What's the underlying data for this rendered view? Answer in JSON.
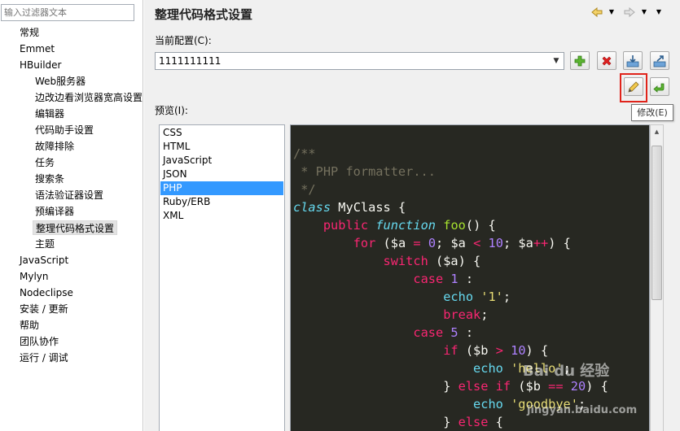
{
  "filter": {
    "placeholder": "输入过滤器文本"
  },
  "tree": [
    {
      "label": "常规",
      "level": 0
    },
    {
      "label": "Emmet",
      "level": 0
    },
    {
      "label": "HBuilder",
      "level": 0
    },
    {
      "label": "Web服务器",
      "level": 1
    },
    {
      "label": "边改边看浏览器宽高设置",
      "level": 1
    },
    {
      "label": "编辑器",
      "level": 1
    },
    {
      "label": "代码助手设置",
      "level": 1
    },
    {
      "label": "故障排除",
      "level": 1
    },
    {
      "label": "任务",
      "level": 1
    },
    {
      "label": "搜索条",
      "level": 1
    },
    {
      "label": "语法验证器设置",
      "level": 1
    },
    {
      "label": "预编译器",
      "level": 1
    },
    {
      "label": "整理代码格式设置",
      "level": 1,
      "selected": true
    },
    {
      "label": "主题",
      "level": 1
    },
    {
      "label": "JavaScript",
      "level": 0
    },
    {
      "label": "Mylyn",
      "level": 0
    },
    {
      "label": "Nodeclipse",
      "level": 0
    },
    {
      "label": "安装 / 更新",
      "level": 0
    },
    {
      "label": "帮助",
      "level": 0
    },
    {
      "label": "团队协作",
      "level": 0
    },
    {
      "label": "运行 / 调试",
      "level": 0
    }
  ],
  "page": {
    "title": "整理代码格式设置",
    "current_profile_label": "当前配置(C):",
    "current_profile_value": "1111111111",
    "preview_label": "预览(I):",
    "edit_tooltip": "修改(E)"
  },
  "icons": {
    "back": "back-arrow-icon",
    "forward": "forward-arrow-icon",
    "add": "plus-icon",
    "remove": "delete-x-icon",
    "import": "import-icon",
    "export": "export-icon",
    "edit": "pencil-icon",
    "undo": "undo-arrow-icon"
  },
  "languages": [
    {
      "label": "CSS"
    },
    {
      "label": "HTML"
    },
    {
      "label": "JavaScript"
    },
    {
      "label": "JSON"
    },
    {
      "label": "PHP",
      "selected": true
    },
    {
      "label": "Ruby/ERB"
    },
    {
      "label": "XML"
    }
  ],
  "code_lines": [
    [
      [
        "c-com",
        "/**"
      ]
    ],
    [
      [
        "c-com",
        " * PHP formatter..."
      ]
    ],
    [
      [
        "c-com",
        " */"
      ]
    ],
    [
      [
        "c-blue c-fn",
        "class"
      ],
      [
        "",
        " MyClass {"
      ]
    ],
    [
      [
        "",
        "    "
      ],
      [
        "c-kw",
        "public"
      ],
      [
        "",
        " "
      ],
      [
        "c-fn",
        "function"
      ],
      [
        "",
        " "
      ],
      [
        "c-name",
        "foo"
      ],
      [
        "",
        "() {"
      ]
    ],
    [
      [
        "",
        "        "
      ],
      [
        "c-kw",
        "for"
      ],
      [
        "",
        " ($a "
      ],
      [
        "c-kw",
        "="
      ],
      [
        "",
        " "
      ],
      [
        "c-num",
        "0"
      ],
      [
        "",
        "; $a "
      ],
      [
        "c-kw",
        "<"
      ],
      [
        "",
        " "
      ],
      [
        "c-num",
        "10"
      ],
      [
        "",
        "; $a"
      ],
      [
        "c-kw",
        "++"
      ],
      [
        "",
        ") {"
      ]
    ],
    [
      [
        "",
        "            "
      ],
      [
        "c-kw",
        "switch"
      ],
      [
        "",
        " ($a) {"
      ]
    ],
    [
      [
        "",
        "                "
      ],
      [
        "c-kw",
        "case"
      ],
      [
        "",
        " "
      ],
      [
        "c-num",
        "1"
      ],
      [
        "",
        " :"
      ]
    ],
    [
      [
        "",
        "                    "
      ],
      [
        "c-blue",
        "echo"
      ],
      [
        "",
        " "
      ],
      [
        "c-str",
        "'1'"
      ],
      [
        "",
        ";"
      ]
    ],
    [
      [
        "",
        "                    "
      ],
      [
        "c-kw",
        "break"
      ],
      [
        "",
        ";"
      ]
    ],
    [
      [
        "",
        "                "
      ],
      [
        "c-kw",
        "case"
      ],
      [
        "",
        " "
      ],
      [
        "c-num",
        "5"
      ],
      [
        "",
        " :"
      ]
    ],
    [
      [
        "",
        "                    "
      ],
      [
        "c-kw",
        "if"
      ],
      [
        "",
        " ($b "
      ],
      [
        "c-kw",
        ">"
      ],
      [
        "",
        " "
      ],
      [
        "c-num",
        "10"
      ],
      [
        "",
        ") {"
      ]
    ],
    [
      [
        "",
        "                        "
      ],
      [
        "c-blue",
        "echo"
      ],
      [
        "",
        " "
      ],
      [
        "c-str",
        "'hello'"
      ],
      [
        "",
        ";"
      ]
    ],
    [
      [
        "",
        "                    } "
      ],
      [
        "c-kw",
        "else if"
      ],
      [
        "",
        " ($b "
      ],
      [
        "c-kw",
        "=="
      ],
      [
        "",
        " "
      ],
      [
        "c-num",
        "20"
      ],
      [
        "",
        ") {"
      ]
    ],
    [
      [
        "",
        "                        "
      ],
      [
        "c-blue",
        "echo"
      ],
      [
        "",
        " "
      ],
      [
        "c-str",
        "'goodbye'"
      ],
      [
        "",
        ";"
      ]
    ],
    [
      [
        "",
        "                    } "
      ],
      [
        "c-kw",
        "else"
      ],
      [
        "",
        " {"
      ]
    ]
  ],
  "watermark": {
    "brand": "Bai du 经验",
    "url": "jingyan.baidu.com"
  }
}
